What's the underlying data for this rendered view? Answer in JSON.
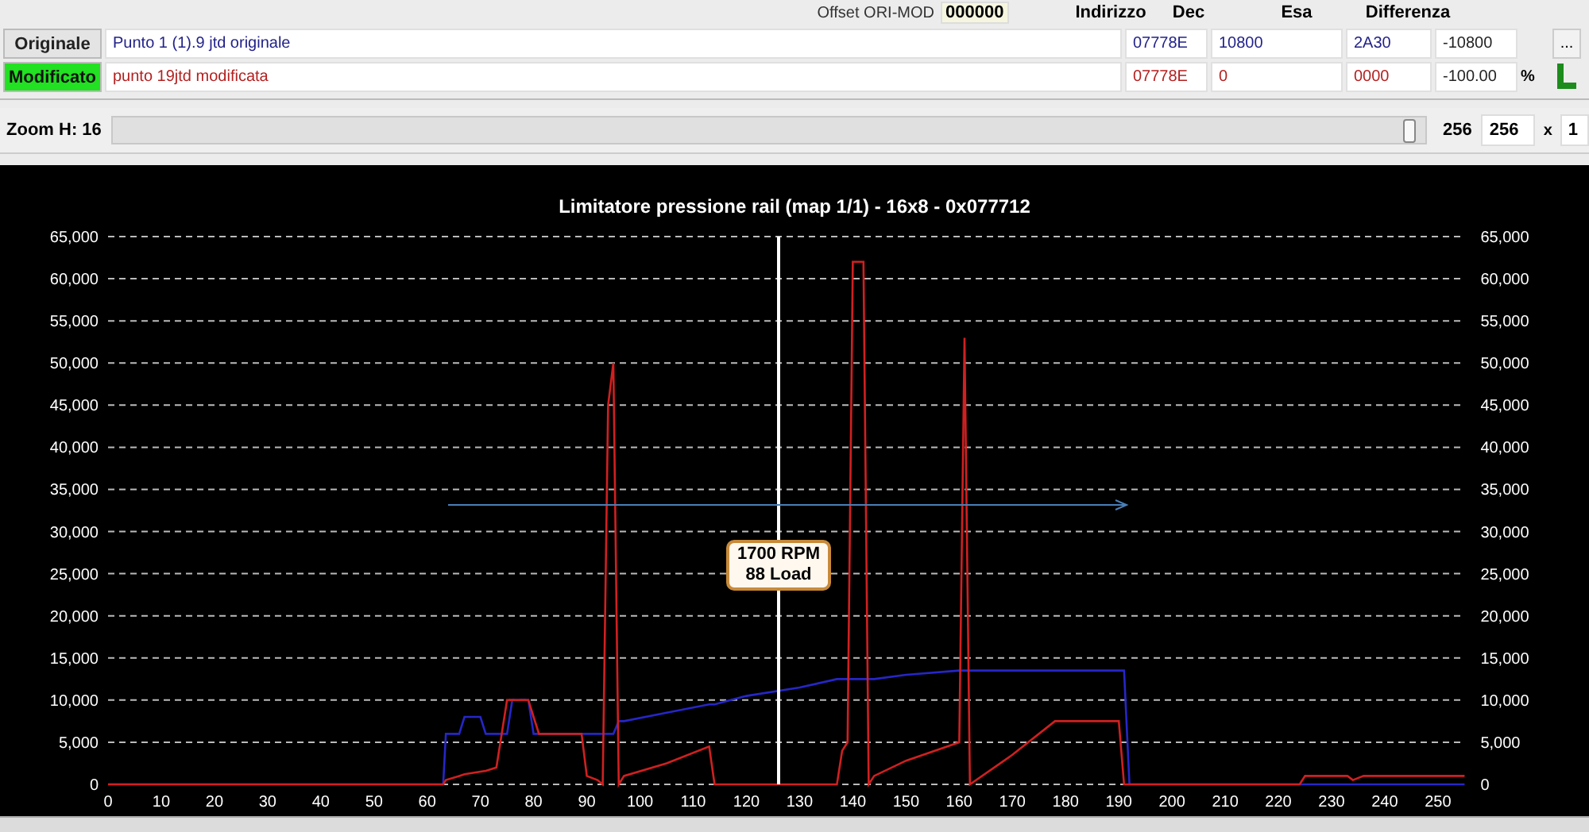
{
  "header": {
    "offset_label": "Offset ORI-MOD",
    "offset_value": "000000",
    "columns": [
      "Indirizzo",
      "Dec",
      "Esa",
      "Differenza"
    ]
  },
  "rows": [
    {
      "kind": "original",
      "label": "Originale",
      "file": "Punto 1 (1).9 jtd originale",
      "address": "07778E",
      "dec": "10800",
      "hex": "2A30",
      "difference": "-10800",
      "action": "..."
    },
    {
      "kind": "modified",
      "label": "Modificato",
      "file": "punto 19jtd modificata",
      "address": "07778E",
      "dec": "0",
      "hex": "0000",
      "difference": "-100.00",
      "unit": "%"
    }
  ],
  "zoom": {
    "label": "Zoom H: 16",
    "level": 0.99,
    "value": "256",
    "field": "256",
    "times": "x",
    "factor": "1"
  },
  "chart_data": {
    "type": "line",
    "title": "Limitatore pressione rail (map 1/1) - 16x8 - 0x077712",
    "x": [
      0,
      63,
      63.5,
      66,
      67,
      70,
      71,
      73,
      75,
      76,
      79,
      80,
      81,
      89,
      90,
      92,
      93,
      94,
      95,
      96,
      97,
      105,
      113,
      114,
      120,
      130,
      137,
      138,
      139,
      140,
      142,
      143,
      144,
      150,
      160,
      161,
      162,
      170,
      178,
      190,
      191,
      192,
      224,
      225,
      233,
      234,
      236,
      255
    ],
    "series": [
      {
        "color": "#2626c8",
        "values": [
          0,
          0,
          6000,
          6000,
          8000,
          8000,
          6000,
          6000,
          6000,
          10000,
          10000,
          6000,
          6000,
          6000,
          6000,
          6000,
          6000,
          6000,
          6000,
          7500,
          7500,
          8500,
          9500,
          9500,
          10500,
          11500,
          12500,
          12500,
          12500,
          12500,
          12500,
          12500,
          12500,
          13000,
          13500,
          13500,
          13500,
          13500,
          13500,
          13500,
          13500,
          0,
          0,
          0,
          0,
          0,
          0,
          0
        ]
      },
      {
        "color": "#d02020",
        "values": [
          0,
          0,
          500,
          1000,
          1200,
          1500,
          1600,
          2000,
          10000,
          10000,
          10000,
          8000,
          6000,
          6000,
          1000,
          500,
          0,
          45000,
          50000,
          0,
          1000,
          2500,
          4500,
          0,
          0,
          0,
          0,
          4000,
          5000,
          62000,
          62000,
          0,
          1000,
          2800,
          5000,
          53000,
          0,
          3500,
          7500,
          7500,
          0,
          0,
          0,
          1000,
          1000,
          500,
          1000,
          1000
        ]
      }
    ],
    "xlim": [
      0,
      255
    ],
    "ylim": [
      0,
      65000
    ],
    "xticks": [
      0,
      10,
      20,
      30,
      40,
      50,
      60,
      70,
      80,
      90,
      100,
      110,
      120,
      130,
      140,
      150,
      160,
      170,
      180,
      190,
      200,
      210,
      220,
      230,
      240,
      250
    ],
    "yticks": [
      {
        "value": 0,
        "label": "0"
      },
      {
        "value": 5000,
        "label": "5,000"
      },
      {
        "value": 10000,
        "label": "10,000"
      },
      {
        "value": 15000,
        "label": "15,000"
      },
      {
        "value": 20000,
        "label": "20,000"
      },
      {
        "value": 25000,
        "label": "25,000"
      },
      {
        "value": 30000,
        "label": "30,000"
      },
      {
        "value": 35000,
        "label": "35,000"
      },
      {
        "value": 40000,
        "label": "40,000"
      },
      {
        "value": 45000,
        "label": "45,000"
      },
      {
        "value": 50000,
        "label": "50,000"
      },
      {
        "value": 55000,
        "label": "55,000"
      },
      {
        "value": 60000,
        "label": "60,000"
      },
      {
        "value": 65000,
        "label": "65,000"
      }
    ],
    "grid": true
  },
  "cursor_tooltip": {
    "lines": [
      "1700 RPM",
      "88 Load"
    ]
  }
}
